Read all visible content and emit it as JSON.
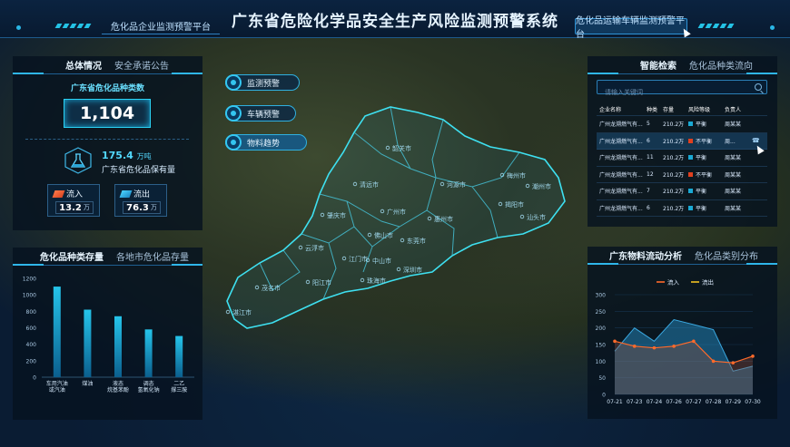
{
  "header": {
    "title": "广东省危险化学品安全生产风险监测预警系统",
    "tab_left": "危化品企业监测预警平台",
    "tab_right": "危化品运输车辆监测预警平台"
  },
  "overview": {
    "tab_active": "总体情况",
    "tab_inactive": "安全承诺公告",
    "kind_label": "广东省危化品种类数",
    "kind_count": "1,104",
    "holding_value": "175.4",
    "holding_unit": "万吨",
    "holding_label": "广东省危化品保有量",
    "flow_in_label": "流入",
    "flow_in_value": "13.2",
    "flow_in_unit": "万",
    "flow_out_label": "流出",
    "flow_out_value": "76.3",
    "flow_out_unit": "万"
  },
  "storage": {
    "tab_active": "危化品种类存量",
    "tab_inactive": "各地市危化品存量"
  },
  "map_buttons": {
    "monitor": "监测预警",
    "vehicle": "车辆预警",
    "material": "物料趋势"
  },
  "map_labels": [
    "韶关市",
    "河源市",
    "梅州市",
    "潮州市",
    "清远市",
    "广州市",
    "揭阳市",
    "汕头市",
    "肇庆市",
    "惠州市",
    "佛山市",
    "东莞市",
    "云浮市",
    "江门市",
    "深圳市",
    "中山市",
    "珠海市",
    "阳江市",
    "茂名市",
    "湛江市"
  ],
  "search": {
    "tab_active": "智能检索",
    "tab_inactive": "危化品种类流向",
    "placeholder": "请输入关键词",
    "columns": [
      "企业名称",
      "种类",
      "存量",
      "风险等级",
      "负责人"
    ],
    "rows": [
      {
        "name": "广州龙溯燃气有...",
        "kind": "5",
        "stock": "210.2万",
        "risk": "平衡",
        "risk_color": "#1aa9d4",
        "person": "周某某"
      },
      {
        "name": "广州龙溯燃气有...",
        "kind": "6",
        "stock": "210.2万",
        "risk": "不平衡",
        "risk_color": "#e0401f",
        "person": "周..."
      },
      {
        "name": "广州龙溯燃气有...",
        "kind": "11",
        "stock": "210.2万",
        "risk": "平衡",
        "risk_color": "#1aa9d4",
        "person": "周某某"
      },
      {
        "name": "广州龙溯燃气有...",
        "kind": "12",
        "stock": "210.2万",
        "risk": "不平衡",
        "risk_color": "#e0401f",
        "person": "周某某"
      },
      {
        "name": "广州龙溯燃气有...",
        "kind": "7",
        "stock": "210.2万",
        "risk": "平衡",
        "risk_color": "#1aa9d4",
        "person": "周某某"
      },
      {
        "name": "广州龙溯燃气有...",
        "kind": "6",
        "stock": "210.2万",
        "risk": "平衡",
        "risk_color": "#1aa9d4",
        "person": "周某某"
      }
    ]
  },
  "flow_analysis": {
    "tab_active": "广东物料流动分析",
    "tab_inactive": "危化品类别分布"
  },
  "chart_data": [
    {
      "type": "bar",
      "categories": [
        "车用汽油或汽油",
        "煤油",
        "液态烷基苯酚",
        "调态氢氧化钠",
        "二乙撑三胺"
      ],
      "category_lines": [
        [
          "车用汽油",
          "或汽油"
        ],
        [
          "煤油"
        ],
        [
          "液态",
          "烷基苯酚"
        ],
        [
          "调态",
          "氢氧化钠"
        ],
        [
          "二乙",
          "撑三胺"
        ]
      ],
      "values": [
        1100,
        820,
        740,
        580,
        500
      ],
      "yticks": [
        0,
        200,
        400,
        600,
        800,
        1000,
        1200
      ],
      "ylim": [
        0,
        1200
      ],
      "color": "#25c4ea"
    },
    {
      "type": "line",
      "categories": [
        "07-21",
        "07-23",
        "07-24",
        "07-26",
        "07-27",
        "07-28",
        "07-29",
        "07-30"
      ],
      "series": [
        {
          "name": "流入",
          "values": [
            160,
            145,
            140,
            145,
            160,
            100,
            95,
            115
          ],
          "color": "#ff6a2a"
        },
        {
          "name": "流出",
          "values": [
            130,
            200,
            160,
            225,
            210,
            195,
            70,
            85
          ],
          "color": "#f0c020"
        }
      ],
      "yticks": [
        0,
        50,
        100,
        150,
        200,
        250,
        300
      ],
      "ylim": [
        0,
        300
      ]
    }
  ]
}
